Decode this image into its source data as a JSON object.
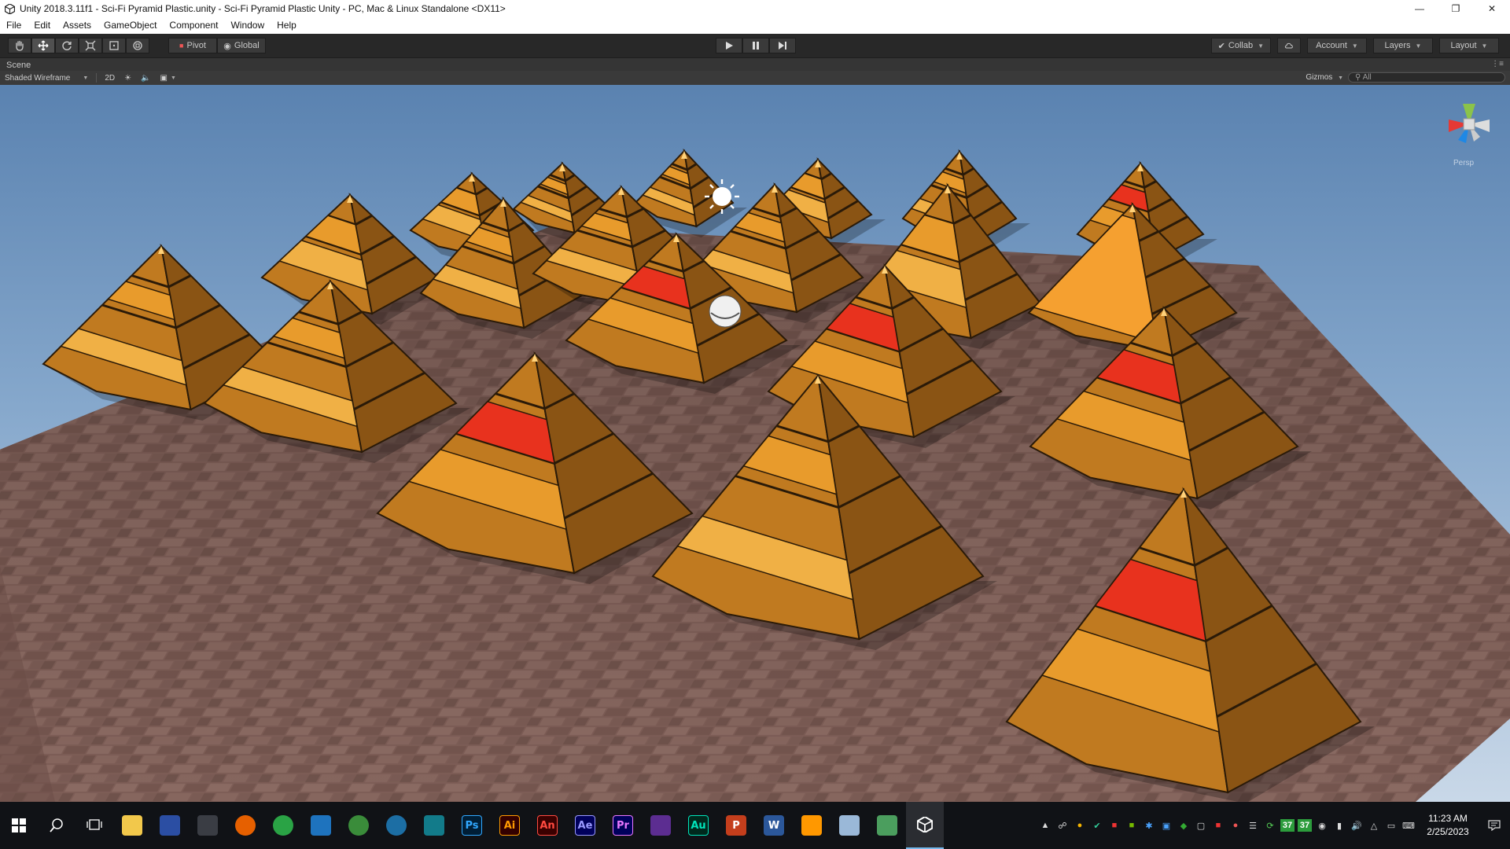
{
  "window": {
    "title": "Unity 2018.3.11f1 - Sci-Fi Pyramid Plastic.unity - Sci-Fi Pyramid Plastic Unity - PC, Mac & Linux Standalone <DX11>"
  },
  "menu": {
    "items": [
      "File",
      "Edit",
      "Assets",
      "GameObject",
      "Component",
      "Window",
      "Help"
    ]
  },
  "toolbar": {
    "pivot_label": "Pivot",
    "global_label": "Global",
    "collab_label": "Collab",
    "account_label": "Account",
    "layers_label": "Layers",
    "layout_label": "Layout"
  },
  "scene": {
    "tab_label": "Scene",
    "shading_mode": "Shaded Wireframe",
    "mode_2d": "2D",
    "gizmos_label": "Gizmos",
    "search_placeholder": "All",
    "gizmo_label": "Persp"
  },
  "taskbar": {
    "apps": [
      {
        "icon": "windows-start-icon",
        "label": ""
      },
      {
        "icon": "search-icon",
        "label": ""
      },
      {
        "icon": "task-view-icon",
        "label": ""
      },
      {
        "icon": "file-explorer-icon",
        "label": "",
        "color": "#f2c84b"
      },
      {
        "icon": "store-icon",
        "label": "",
        "color": "#2b4ea3"
      },
      {
        "icon": "paint-icon",
        "label": "",
        "color": "#3a3d44"
      },
      {
        "icon": "firefox-icon",
        "label": "",
        "color": "#e66000"
      },
      {
        "icon": "chrome-icon",
        "label": "",
        "color": "#2aa345"
      },
      {
        "icon": "magnifier-icon",
        "label": "",
        "color": "#1e73be"
      },
      {
        "icon": "globe-icon",
        "label": "",
        "color": "#3a8c3a"
      },
      {
        "icon": "earth-icon",
        "label": "",
        "color": "#1c6ea4"
      },
      {
        "icon": "app-teal-icon",
        "label": "",
        "color": "#127b8a"
      },
      {
        "icon": "photoshop-icon",
        "label": "Ps",
        "color": "#001e36",
        "fg": "#31a8ff"
      },
      {
        "icon": "illustrator-icon",
        "label": "Ai",
        "color": "#330000",
        "fg": "#ff9a00"
      },
      {
        "icon": "animate-icon",
        "label": "An",
        "color": "#3a0000",
        "fg": "#ff4a40"
      },
      {
        "icon": "after-effects-icon",
        "label": "Ae",
        "color": "#00005b",
        "fg": "#9999ff"
      },
      {
        "icon": "premiere-icon",
        "label": "Pr",
        "color": "#00005b",
        "fg": "#ea77ff"
      },
      {
        "icon": "visual-studio-icon",
        "label": "",
        "color": "#5c2d91"
      },
      {
        "icon": "audition-icon",
        "label": "Au",
        "color": "#00291d",
        "fg": "#00e4bb"
      },
      {
        "icon": "powerpoint-icon",
        "label": "P",
        "color": "#c43e1c"
      },
      {
        "icon": "word-icon",
        "label": "W",
        "color": "#2b579a"
      },
      {
        "icon": "sublime-icon",
        "label": "",
        "color": "#ff9800"
      },
      {
        "icon": "notepad-icon",
        "label": "",
        "color": "#9ab8d8"
      },
      {
        "icon": "app-diamond-icon",
        "label": "",
        "color": "#4b9e5e"
      },
      {
        "icon": "unity-icon",
        "label": "",
        "color": "#222222"
      }
    ]
  },
  "tray": {
    "badge_a": "37",
    "badge_b": "37",
    "time": "11:23 AM",
    "date": "2/25/2023"
  },
  "colors": {
    "toolbar_bg": "#282828",
    "scene_bar_bg": "#353535",
    "taskbar_bg": "#101216",
    "pyramid_gold": "#e89b2c",
    "pyramid_red": "#e8321e",
    "floor_brick": "#7a5a52"
  }
}
